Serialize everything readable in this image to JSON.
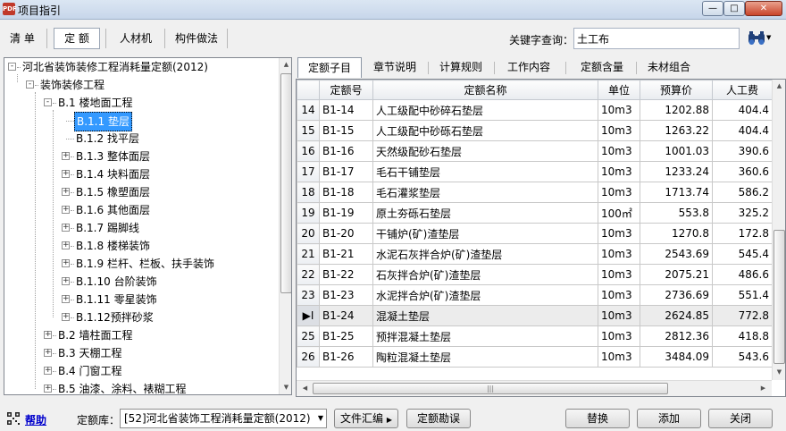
{
  "window": {
    "title": "项目指引",
    "app_icon": "PDF"
  },
  "toolbar": {
    "tabs": [
      "清 单",
      "定 额",
      "人材机",
      "构件做法"
    ],
    "active_tab": "定 额",
    "keyword_label": "关键字查询：",
    "keyword_value": "土工布"
  },
  "tree": {
    "nodes": [
      {
        "label": "河北省装饰装修工程消耗量定额(2012)",
        "level": 0,
        "expander": "-"
      },
      {
        "label": "装饰装修工程",
        "level": 1,
        "expander": "-"
      },
      {
        "label": "B.1 楼地面工程",
        "level": 2,
        "expander": "-"
      },
      {
        "label": "B.1.1 垫层",
        "level": 3,
        "expander": "",
        "selected": true
      },
      {
        "label": "B.1.2 找平层",
        "level": 3,
        "expander": ""
      },
      {
        "label": "B.1.3 整体面层",
        "level": 3,
        "expander": "+"
      },
      {
        "label": "B.1.4 块料面层",
        "level": 3,
        "expander": "+"
      },
      {
        "label": "B.1.5 橡塑面层",
        "level": 3,
        "expander": "+"
      },
      {
        "label": "B.1.6 其他面层",
        "level": 3,
        "expander": "+"
      },
      {
        "label": "B.1.7 踢脚线",
        "level": 3,
        "expander": "+"
      },
      {
        "label": "B.1.8 楼梯装饰",
        "level": 3,
        "expander": "+"
      },
      {
        "label": "B.1.9 栏杆、栏板、扶手装饰",
        "level": 3,
        "expander": "+"
      },
      {
        "label": "B.1.10 台阶装饰",
        "level": 3,
        "expander": "+"
      },
      {
        "label": "B.1.11 零星装饰",
        "level": 3,
        "expander": "+"
      },
      {
        "label": "B.1.12预拌砂浆",
        "level": 3,
        "expander": "+"
      },
      {
        "label": "B.2 墙柱面工程",
        "level": 2,
        "expander": "+"
      },
      {
        "label": "B.3 天棚工程",
        "level": 2,
        "expander": "+"
      },
      {
        "label": "B.4 门窗工程",
        "level": 2,
        "expander": "+"
      },
      {
        "label": "B.5 油漆、涂料、裱糊工程",
        "level": 2,
        "expander": "+"
      }
    ]
  },
  "detail_tabs": [
    "定额子目",
    "章节说明",
    "计算规则",
    "工作内容",
    "定额含量",
    "未材组合"
  ],
  "active_detail_tab": "定额子目",
  "grid": {
    "columns": [
      "",
      "定额号",
      "定额名称",
      "单位",
      "预算价",
      "人工费"
    ],
    "current_row_marker": "▶I",
    "rows": [
      {
        "n": "14",
        "code": "B1-14",
        "name": "人工级配中砂碎石垫层",
        "unit": "10m3",
        "price": "1202.88",
        "labor": "404.4"
      },
      {
        "n": "15",
        "code": "B1-15",
        "name": "人工级配中砂砾石垫层",
        "unit": "10m3",
        "price": "1263.22",
        "labor": "404.4"
      },
      {
        "n": "16",
        "code": "B1-16",
        "name": "天然级配砂石垫层",
        "unit": "10m3",
        "price": "1001.03",
        "labor": "390.6"
      },
      {
        "n": "17",
        "code": "B1-17",
        "name": "毛石干铺垫层",
        "unit": "10m3",
        "price": "1233.24",
        "labor": "360.6"
      },
      {
        "n": "18",
        "code": "B1-18",
        "name": "毛石灌浆垫层",
        "unit": "10m3",
        "price": "1713.74",
        "labor": "586.2"
      },
      {
        "n": "19",
        "code": "B1-19",
        "name": "原土夯砾石垫层",
        "unit": "100㎡",
        "price": "553.8",
        "labor": "325.2"
      },
      {
        "n": "20",
        "code": "B1-20",
        "name": "干铺炉(矿)渣垫层",
        "unit": "10m3",
        "price": "1270.8",
        "labor": "172.8"
      },
      {
        "n": "21",
        "code": "B1-21",
        "name": "水泥石灰拌合炉(矿)渣垫层",
        "unit": "10m3",
        "price": "2543.69",
        "labor": "545.4"
      },
      {
        "n": "22",
        "code": "B1-22",
        "name": "石灰拌合炉(矿)渣垫层",
        "unit": "10m3",
        "price": "2075.21",
        "labor": "486.6"
      },
      {
        "n": "23",
        "code": "B1-23",
        "name": "水泥拌合炉(矿)渣垫层",
        "unit": "10m3",
        "price": "2736.69",
        "labor": "551.4"
      },
      {
        "n": "",
        "code": "B1-24",
        "name": "混凝土垫层",
        "unit": "10m3",
        "price": "2624.85",
        "labor": "772.8",
        "current": true
      },
      {
        "n": "25",
        "code": "B1-25",
        "name": "预拌混凝土垫层",
        "unit": "10m3",
        "price": "2812.36",
        "labor": "418.8"
      },
      {
        "n": "26",
        "code": "B1-26",
        "name": "陶粒混凝土垫层",
        "unit": "10m3",
        "price": "3484.09",
        "labor": "543.6"
      }
    ]
  },
  "bottom": {
    "help_label": "帮助",
    "library_label": "定额库：",
    "library_value": "[52]河北省装饰工程消耗量定额(2012)",
    "file_button": "文件汇编",
    "errata_button": "定额勘误",
    "replace_button": "替换",
    "add_button": "添加",
    "close_button": "关闭"
  }
}
